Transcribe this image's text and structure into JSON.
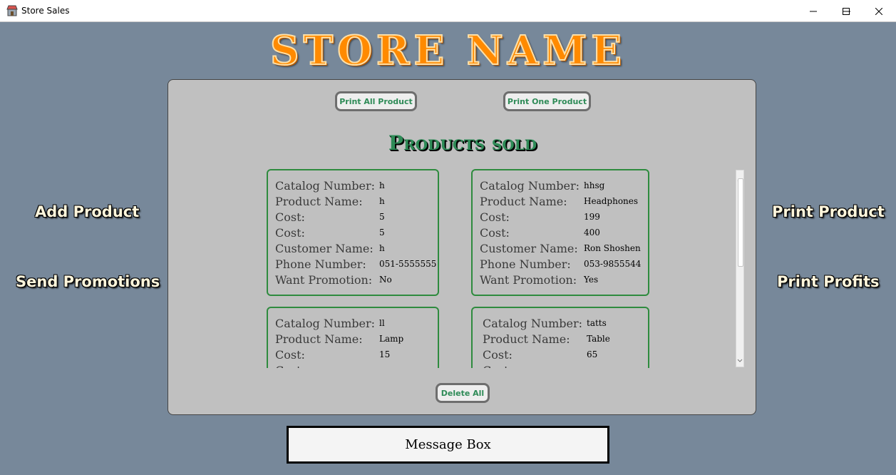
{
  "window": {
    "title": "Store Sales"
  },
  "header": {
    "store_name": "STORE NAME"
  },
  "panel": {
    "print_all_label": "Print All Product",
    "print_one_label": "Print One Product",
    "section_title": "Products sold",
    "delete_all_label": "Delete All"
  },
  "field_labels": {
    "catalog": "Catalog Number:",
    "name": "Product Name:",
    "cost": "Cost:",
    "cost2": "Cost:",
    "customer": "Customer Name:",
    "phone": "Phone Number:",
    "promotion": "Want Promotion:"
  },
  "products": [
    {
      "catalog": "h",
      "name": "h",
      "cost": "5",
      "cost2": "5",
      "customer": "h",
      "phone": "051-5555555",
      "promotion": "No"
    },
    {
      "catalog": "hhsg",
      "name": "Headphones",
      "cost": "199",
      "cost2": "400",
      "customer": "Ron Shoshen",
      "phone": "053-9855544",
      "promotion": "Yes"
    },
    {
      "catalog": "ll",
      "name": "Lamp",
      "cost": "15"
    },
    {
      "catalog": "tatts",
      "name": "Table",
      "cost": "65"
    }
  ],
  "sidebar_left": {
    "add_product": "Add Product",
    "send_promotions": "Send Promotions"
  },
  "sidebar_right": {
    "print_product": "Print Product",
    "print_profits": "Print Profits"
  },
  "message_box": {
    "text": "Message Box"
  },
  "colors": {
    "background": "#77889a",
    "accent_green": "#2e8b57",
    "store_name_orange": "#ff8a00",
    "panel": "#c0c0c0"
  },
  "icons": {
    "app": "store-icon",
    "minimize": "minimize-icon",
    "maximize": "maximize-icon",
    "close": "close-icon"
  }
}
